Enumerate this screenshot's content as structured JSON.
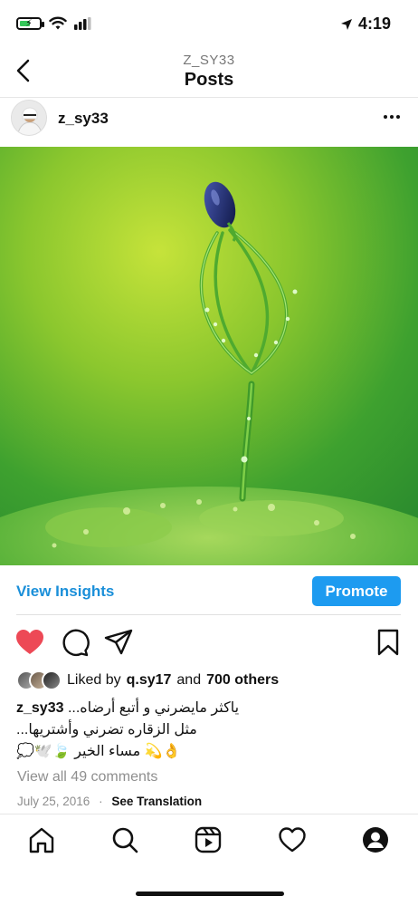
{
  "status_bar": {
    "time": "4:19",
    "icons": [
      "battery-charging-icon",
      "wifi-icon",
      "cellular-signal-icon",
      "location-arrow-icon"
    ]
  },
  "header": {
    "username": "Z_SY33",
    "title": "Posts",
    "icons": [
      "chevron-left-icon"
    ]
  },
  "post": {
    "username": "z_sy33",
    "icons": [
      "avatar-image",
      "more-options-icon"
    ]
  },
  "insights": {
    "view_label": "View Insights",
    "promote_label": "Promote"
  },
  "actions": {
    "icons": [
      "heart-filled-icon",
      "comment-icon",
      "share-icon",
      "bookmark-icon"
    ],
    "accent_color": "#ed4956"
  },
  "likes": {
    "prefix": "Liked by",
    "user": "q.sy17",
    "mid": "and",
    "others": "700 others"
  },
  "caption": {
    "username": "z_sy33",
    "line1": "ياكثر مايضرني و أتبع أرضاه...",
    "line2": "مثل الزقاره تضرني وأشتريها...",
    "line3": "👌💫 مساء الخير 🍃🕊️💭"
  },
  "comments": {
    "label": "View all 49 comments"
  },
  "meta": {
    "date": "July 25, 2016",
    "separator": "·",
    "translate": "See Translation"
  },
  "tabbar": {
    "icons": [
      "home-icon",
      "search-icon",
      "reels-icon",
      "activity-heart-icon",
      "profile-icon"
    ]
  },
  "colors": {
    "link_blue": "#1a8fd9",
    "promote_blue": "#1d9bf0",
    "heart_red": "#ed4956"
  }
}
